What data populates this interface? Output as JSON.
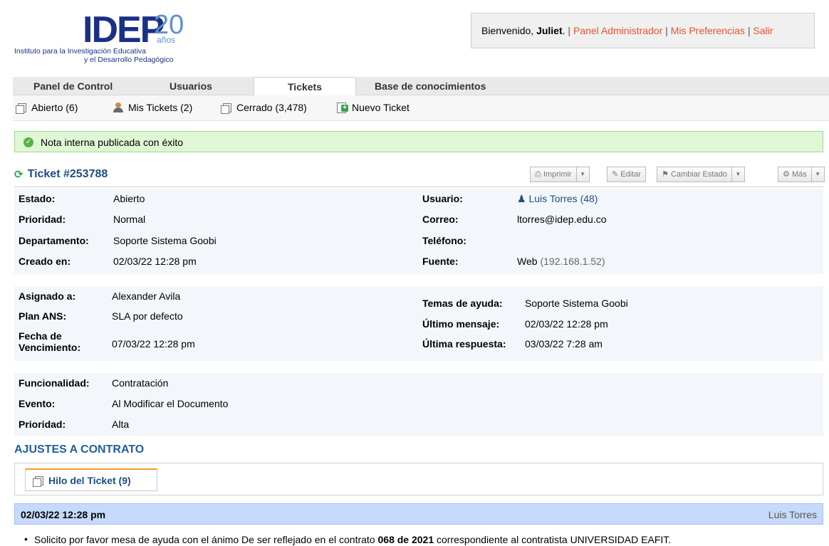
{
  "header": {
    "logo": {
      "brand": "IDEP",
      "anniversary_number": "20",
      "anniversary_word": "años",
      "subtitle_line1": "Instituto para la Investigación Educativa",
      "subtitle_line2": "y el Desarrollo Pedagógico"
    },
    "user": {
      "greeting": "Bienvenido,",
      "name": "Juliet",
      "admin_panel": "Panel Administrador",
      "preferences": "Mis Preferencias",
      "logout": "Salir"
    }
  },
  "nav": {
    "tabs": [
      {
        "label": "Panel de Control"
      },
      {
        "label": "Usuarios"
      },
      {
        "label": "Tickets",
        "active": true
      },
      {
        "label": "Base de conocimientos"
      }
    ]
  },
  "subnav": {
    "items": [
      {
        "label": "Abierto (6)",
        "icon": "tickets-icon"
      },
      {
        "label": "Mis Tickets (2)",
        "icon": "user-icon"
      },
      {
        "label": "Cerrado (3,478)",
        "icon": "tickets-icon"
      },
      {
        "label": "Nuevo Ticket",
        "icon": "new-ticket-icon"
      }
    ]
  },
  "notice": {
    "text": "Nota interna publicada con éxito",
    "color": "#dff7d5"
  },
  "ticket": {
    "title": "Ticket #253788",
    "actions": {
      "print": "Imprimir",
      "edit": "Editar",
      "change_status": "Cambiar Estado",
      "more": "Más"
    },
    "block1": {
      "left": [
        {
          "label": "Estado:",
          "value": "Abierto"
        },
        {
          "label": "Prioridad:",
          "value": "Normal"
        },
        {
          "label": "Departamento:",
          "value": "Soporte Sistema Goobi"
        },
        {
          "label": "Creado en:",
          "value": "02/03/22 12:28 pm"
        }
      ],
      "right": {
        "user_label": "Usuario:",
        "user_name": "Luis Torres",
        "user_count": "(48)",
        "email_label": "Correo:",
        "email": "ltorres@idep.edu.co",
        "phone_label": "Teléfono:",
        "phone": "",
        "source_label": "Fuente:",
        "source": "Web",
        "source_ip": "(192.168.1.52)"
      }
    },
    "block2": {
      "left": [
        {
          "label": "Asignado a:",
          "value": "Alexander Avila"
        },
        {
          "label": "Plan ANS:",
          "value": "SLA por defecto"
        }
      ],
      "due_label_line1": "Fecha de",
      "due_label_line2": "Vencimiento:",
      "due_value": "07/03/22 12:28 pm",
      "right": [
        {
          "label": "Temas de ayuda:",
          "value": "Soporte Sistema Goobi"
        },
        {
          "label": "Último mensaje:",
          "value": "02/03/22 12:28 pm"
        },
        {
          "label": "Última respuesta:",
          "value": "03/03/22 7:28 am"
        }
      ]
    },
    "block3": [
      {
        "label": "Funcionalidad:",
        "value": "Contratación"
      },
      {
        "label": "Evento:",
        "value": "Al Modificar el Documento"
      },
      {
        "label": "Prioridad:",
        "value": "Alta"
      }
    ],
    "subject": "AJUSTES A CONTRATO",
    "thread_tab": "Hilo del Ticket (9)",
    "entry": {
      "date": "02/03/22 12:28 pm",
      "author": "Luis Torres",
      "text_start": "Solicito por favor mesa de ayuda con el ánimo De ser reflejado en el contrato",
      "text_bold": "068 de 2021",
      "text_end": "correspondiente al contratista UNIVERSIDAD EAFIT."
    }
  }
}
